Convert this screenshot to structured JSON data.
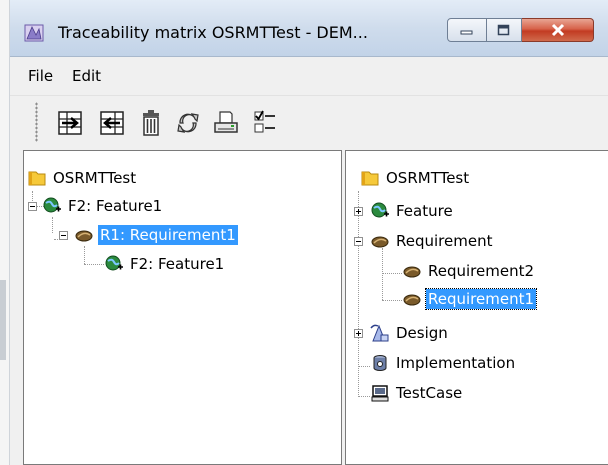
{
  "window": {
    "title": "Traceability matrix OSRMTTest - DEM..."
  },
  "menubar": {
    "items": [
      {
        "label": "File"
      },
      {
        "label": "Edit"
      }
    ]
  },
  "toolbar": {
    "buttons": [
      {
        "icon": "add-trace-icon"
      },
      {
        "icon": "remove-trace-icon"
      },
      {
        "icon": "trash-icon"
      },
      {
        "icon": "refresh-icon"
      },
      {
        "icon": "print-icon"
      },
      {
        "icon": "checklist-icon"
      }
    ]
  },
  "left_tree": {
    "root": "OSRMTTest",
    "items": [
      {
        "label": "F2: Feature1",
        "icon": "globe-plus-icon",
        "expanded": true
      },
      {
        "label": "R1: Requirement1",
        "icon": "requirement-icon",
        "expanded": true,
        "selected": true
      },
      {
        "label": "F2: Feature1",
        "icon": "globe-plus-icon"
      }
    ]
  },
  "right_tree": {
    "root": "OSRMTTest",
    "items": [
      {
        "label": "Feature",
        "icon": "globe-plus-icon",
        "expanded": false
      },
      {
        "label": "Requirement",
        "icon": "requirement-icon",
        "expanded": true
      },
      {
        "label": "Requirement2",
        "icon": "requirement-icon"
      },
      {
        "label": "Requirement1",
        "icon": "requirement-icon",
        "selected": true
      },
      {
        "label": "Design",
        "icon": "design-icon",
        "expanded": false
      },
      {
        "label": "Implementation",
        "icon": "database-icon"
      },
      {
        "label": "TestCase",
        "icon": "computer-icon"
      }
    ]
  },
  "colors": {
    "selection": "#3399ff",
    "close_button": "#c23b22"
  }
}
